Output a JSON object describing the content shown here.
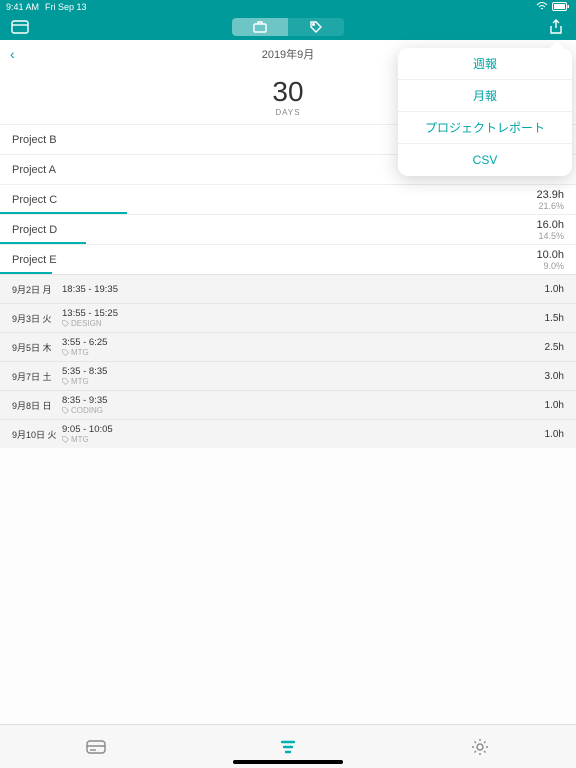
{
  "status": {
    "time": "9:41 AM",
    "date": "Fri Sep 13"
  },
  "nav": {
    "month_label": "2019年9月"
  },
  "summary": {
    "days_value": "30",
    "days_label": "DAYS"
  },
  "popover": {
    "items": [
      {
        "label": "週報"
      },
      {
        "label": "月報"
      },
      {
        "label": "プロジェクトレポート"
      },
      {
        "label": "CSV"
      }
    ]
  },
  "projects": [
    {
      "name": "Project B",
      "hours": "",
      "pct": "",
      "bar": 0
    },
    {
      "name": "Project A",
      "hours": "",
      "pct": "",
      "bar": 0
    },
    {
      "name": "Project C",
      "hours": "23.9h",
      "pct": "21.6%",
      "bar": 22
    },
    {
      "name": "Project D",
      "hours": "16.0h",
      "pct": "14.5%",
      "bar": 15
    },
    {
      "name": "Project E",
      "hours": "10.0h",
      "pct": "9.0%",
      "bar": 9
    }
  ],
  "entries": [
    {
      "date": "9月2日 月",
      "time": "18:35 - 19:35",
      "tag": "",
      "dur": "1.0h"
    },
    {
      "date": "9月3日 火",
      "time": "13:55 - 15:25",
      "tag": "DESIGN",
      "dur": "1.5h"
    },
    {
      "date": "9月5日 木",
      "time": "3:55 - 6:25",
      "tag": "MTG",
      "dur": "2.5h"
    },
    {
      "date": "9月7日 土",
      "time": "5:35 - 8:35",
      "tag": "MTG",
      "dur": "3.0h"
    },
    {
      "date": "9月8日 日",
      "time": "8:35 - 9:35",
      "tag": "CODING",
      "dur": "1.0h"
    },
    {
      "date": "9月10日 火",
      "time": "9:05 - 10:05",
      "tag": "MTG",
      "dur": "1.0h"
    }
  ]
}
